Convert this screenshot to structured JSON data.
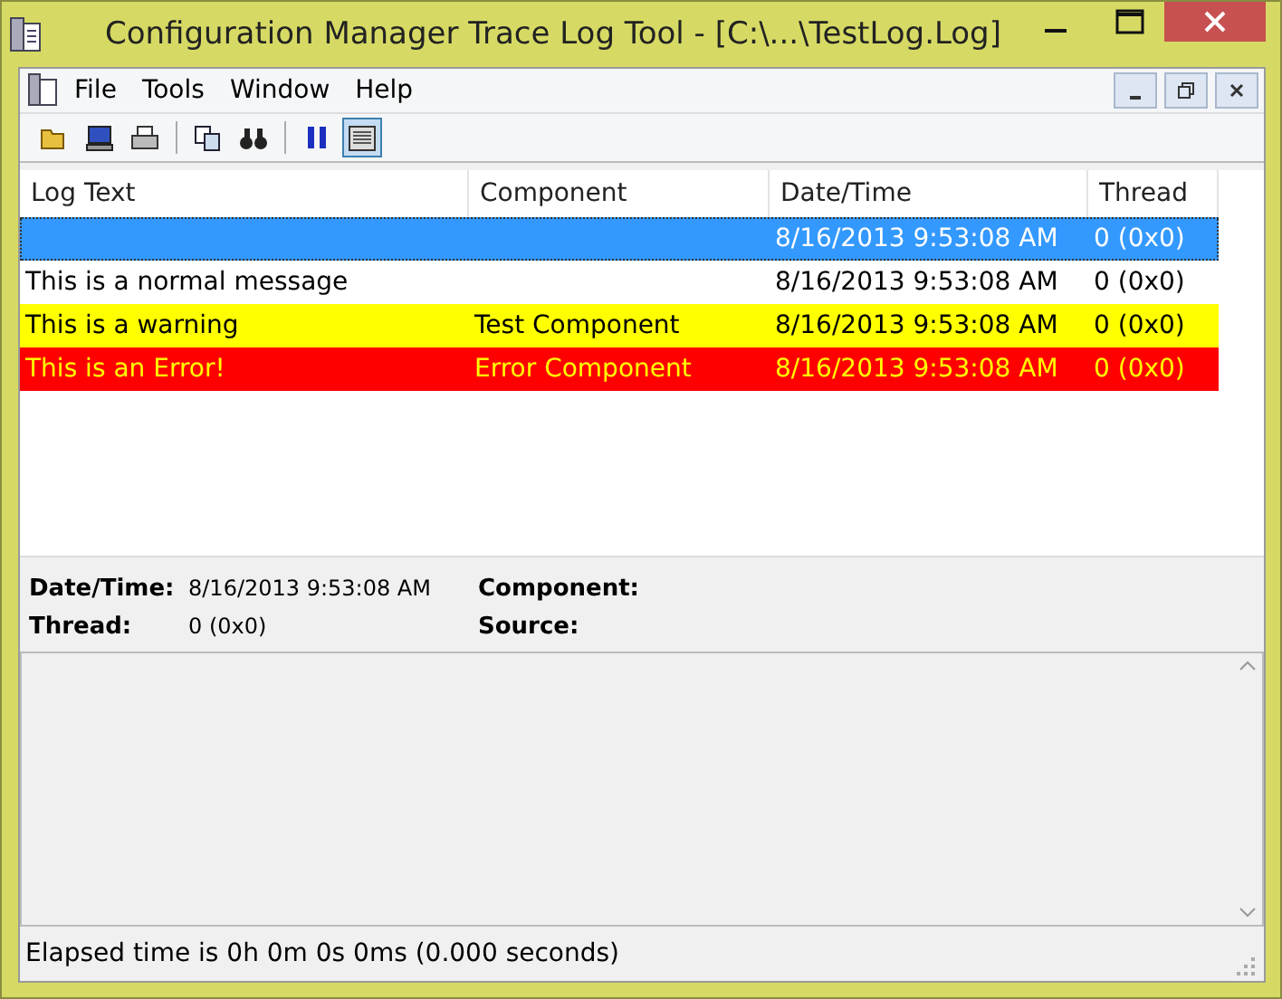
{
  "window": {
    "title": "Configuration Manager Trace Log Tool - [C:\\...\\TestLog.Log]"
  },
  "menu": [
    "File",
    "Tools",
    "Window",
    "Help"
  ],
  "toolbar": [
    {
      "kind": "open",
      "selected": false
    },
    {
      "kind": "computer",
      "selected": false
    },
    {
      "kind": "print",
      "selected": false
    },
    {
      "kind": "separator"
    },
    {
      "kind": "copy",
      "selected": false
    },
    {
      "kind": "find",
      "selected": false
    },
    {
      "kind": "separator"
    },
    {
      "kind": "pause",
      "selected": false
    },
    {
      "kind": "panel",
      "selected": true
    }
  ],
  "table": {
    "columns": [
      "Log Text",
      "Component",
      "Date/Time",
      "Thread"
    ],
    "rows": [
      {
        "kind": "normal",
        "selected": true,
        "cells": [
          "",
          "",
          "8/16/2013 9:53:08 AM",
          "0 (0x0)"
        ]
      },
      {
        "kind": "normal",
        "selected": false,
        "cells": [
          "This is a normal message",
          "",
          "8/16/2013 9:53:08 AM",
          "0 (0x0)"
        ]
      },
      {
        "kind": "warning",
        "selected": false,
        "cells": [
          "This is a warning",
          "Test Component",
          "8/16/2013 9:53:08 AM",
          "0 (0x0)"
        ]
      },
      {
        "kind": "error",
        "selected": false,
        "cells": [
          "This is an Error!",
          "Error Component",
          "8/16/2013 9:53:08 AM",
          "0 (0x0)"
        ]
      }
    ]
  },
  "details": {
    "left": [
      {
        "label": "Date/Time:",
        "value": "8/16/2013 9:53:08 AM"
      },
      {
        "label": "Thread:",
        "value": "0 (0x0)"
      }
    ],
    "right": [
      {
        "label": "Component:"
      },
      {
        "label": "Source:"
      }
    ]
  },
  "status_bar": "Elapsed time is 0h 0m 0s 0ms (0.000 seconds)"
}
